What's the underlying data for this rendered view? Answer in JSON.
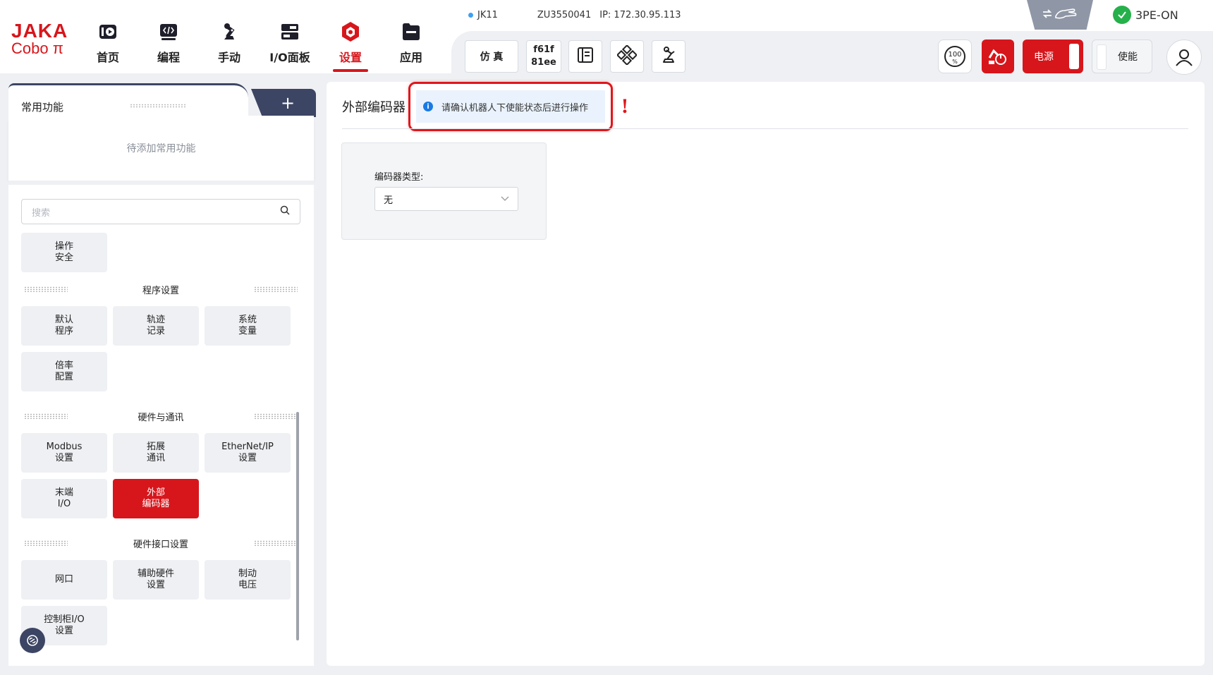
{
  "app": {
    "logo_line1": "JAKA",
    "logo_line2": "Cobo π",
    "brand_color": "#d7161c"
  },
  "nav": {
    "items": [
      {
        "label": "首页",
        "icon": "home-icon"
      },
      {
        "label": "编程",
        "icon": "code-icon"
      },
      {
        "label": "手动",
        "icon": "robot-arm-icon"
      },
      {
        "label": "I/O面板",
        "icon": "io-panel-icon"
      },
      {
        "label": "设置",
        "icon": "settings-icon",
        "active": true
      },
      {
        "label": "应用",
        "icon": "folder-icon"
      }
    ]
  },
  "status": {
    "robot_name": "JK11",
    "serial": "ZU3550041",
    "ip": "IP: 172.30.95.113"
  },
  "toolbar": {
    "sim_label": "仿 真",
    "version_line1": "f61f",
    "version_line2": "81ee",
    "speed_label": "100\n%",
    "power_label": "电源",
    "enable_label": "使能",
    "pe_status": "3PE-ON"
  },
  "favorites": {
    "tab_label": "常用功能",
    "add_label": "+",
    "empty_text": "待添加常用功能"
  },
  "sidebar": {
    "search_placeholder": "搜索",
    "top_items": [
      {
        "label": "操作\n安全"
      }
    ],
    "sections": [
      {
        "title": "程序设置",
        "items": [
          {
            "label": "默认\n程序"
          },
          {
            "label": "轨迹\n记录"
          },
          {
            "label": "系统\n变量"
          },
          {
            "label": "倍率\n配置"
          }
        ]
      },
      {
        "title": "硬件与通讯",
        "items": [
          {
            "label": "Modbus\n设置"
          },
          {
            "label": "拓展\n通讯"
          },
          {
            "label": "EtherNet/IP\n设置"
          },
          {
            "label": "末端\nI/O"
          },
          {
            "label": "外部\n编码器",
            "active": true
          }
        ]
      },
      {
        "title": "硬件接口设置",
        "items": [
          {
            "label": "网口"
          },
          {
            "label": "辅助硬件\n设置"
          },
          {
            "label": "制动\n电压"
          },
          {
            "label": "控制柜I/O\n设置"
          }
        ]
      }
    ]
  },
  "main": {
    "title": "外部编码器",
    "notice": "请确认机器人下使能状态后进行操作",
    "notice_mark": "!",
    "encoder_label": "编码器类型:",
    "encoder_value": "无"
  }
}
